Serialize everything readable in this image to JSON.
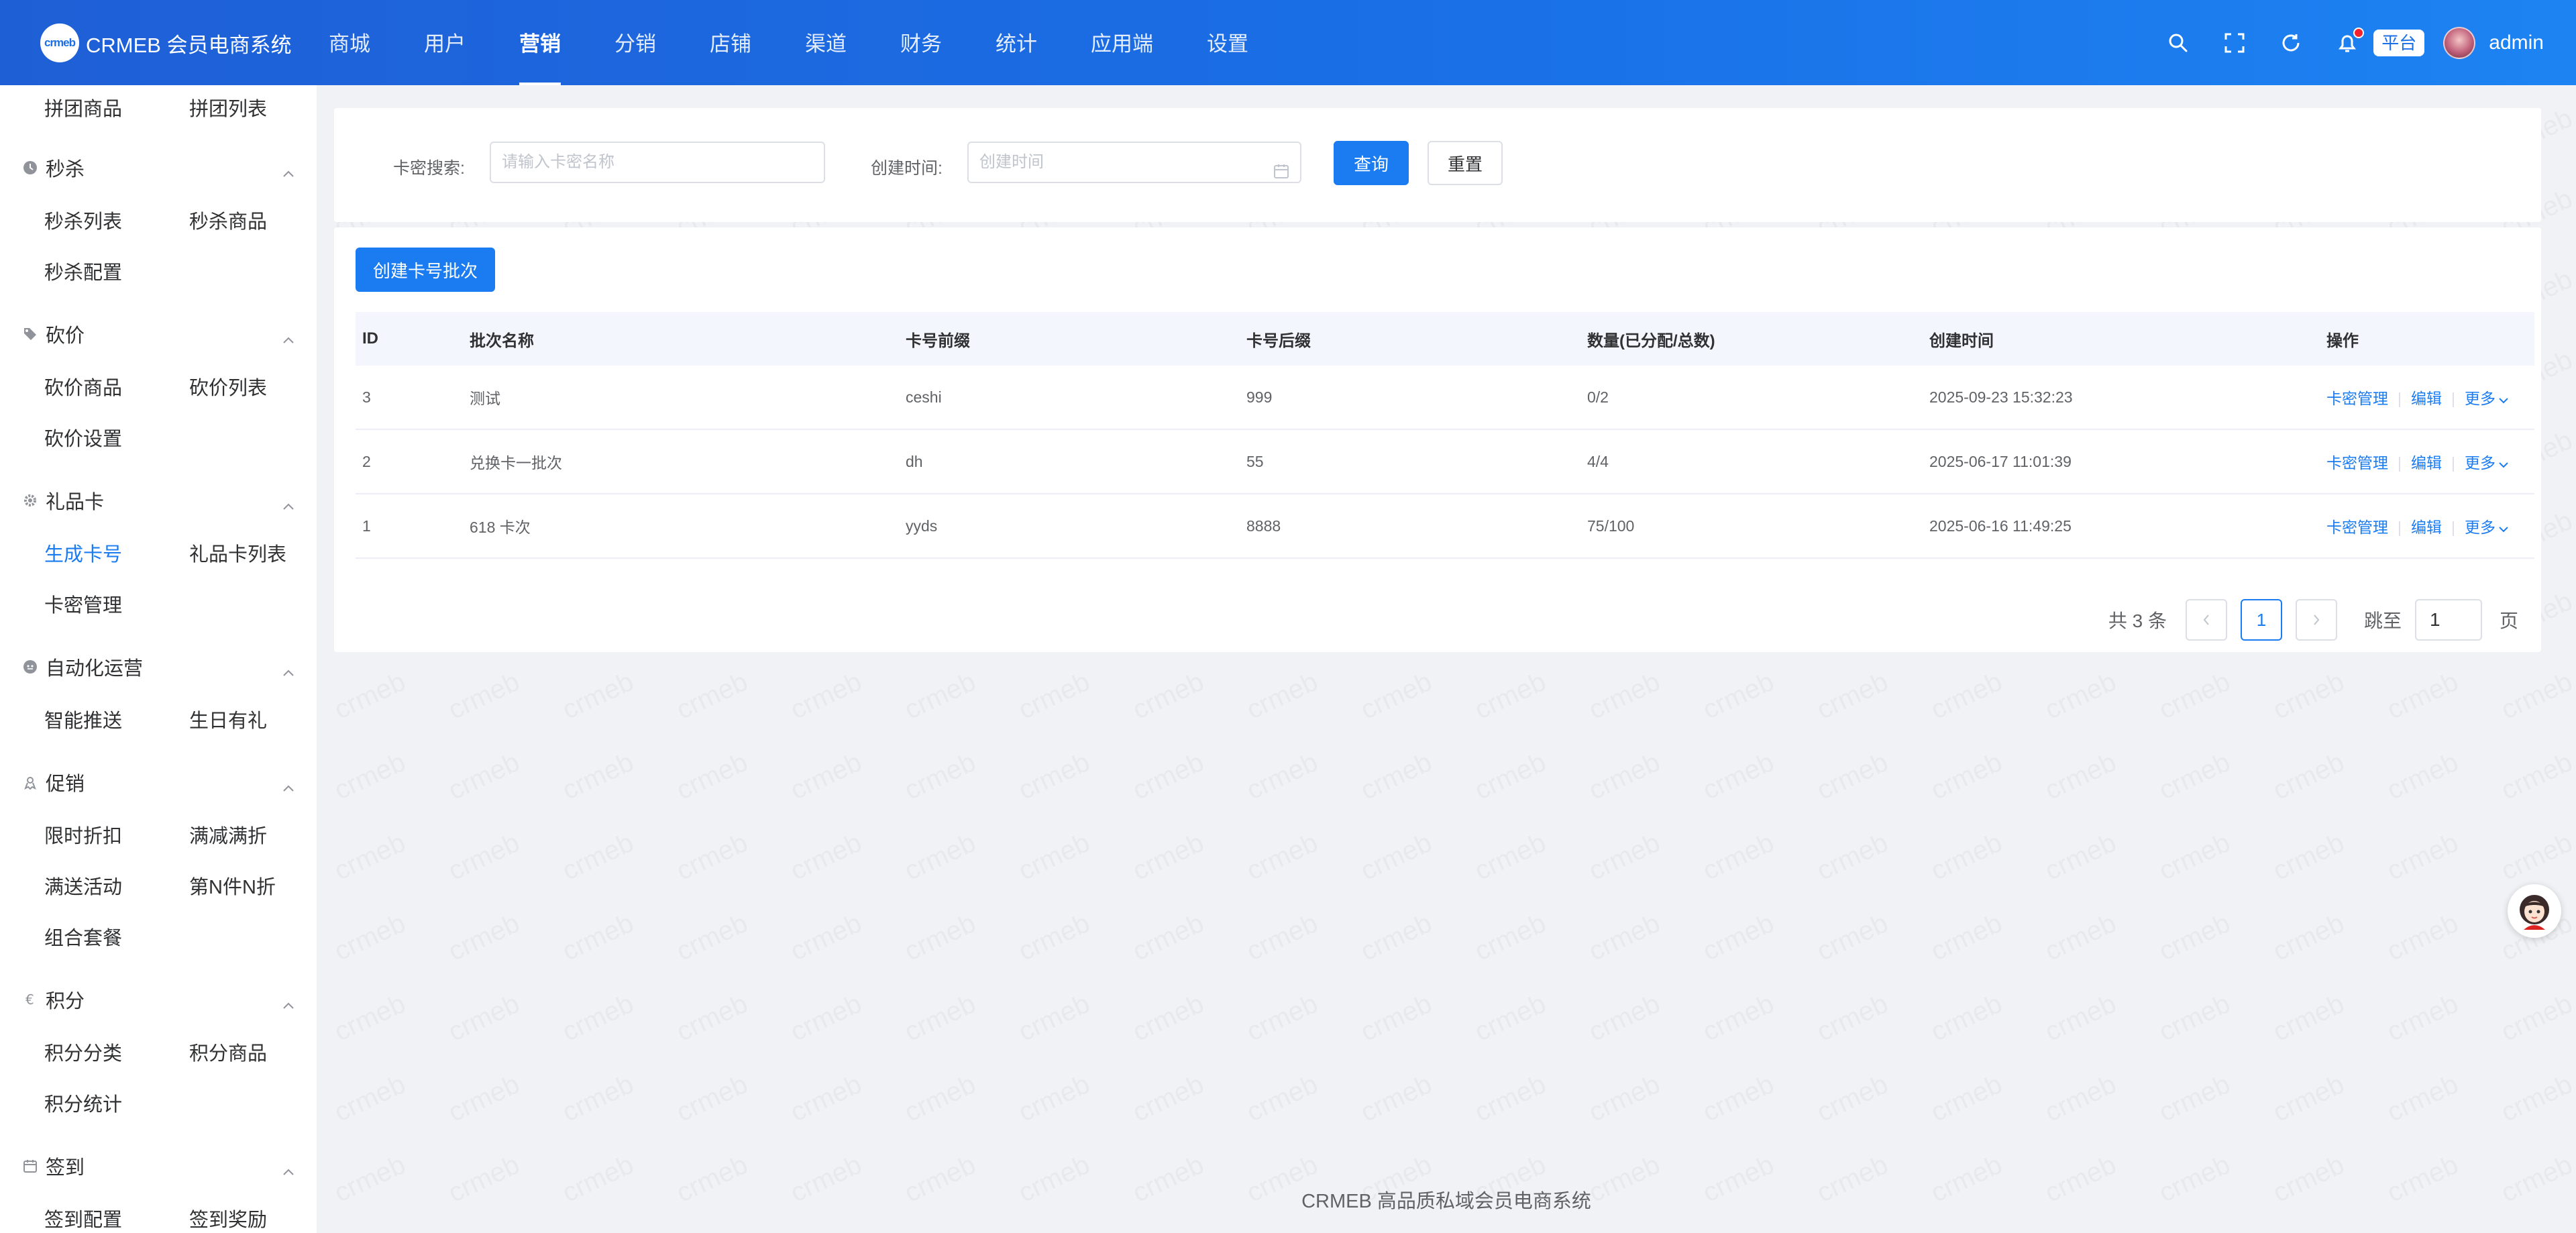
{
  "header": {
    "logo_mark": "crmeb",
    "app_title": "CRMEB 会员电商系统",
    "nav": [
      "商城",
      "用户",
      "营销",
      "分销",
      "店铺",
      "渠道",
      "财务",
      "统计",
      "应用端",
      "设置"
    ],
    "active_nav": "营销",
    "platform_tag": "平台",
    "user_name": "admin",
    "accent": "#1a6fe6"
  },
  "sidebar": {
    "pintuan_items": [
      "拼团商品",
      "拼团列表"
    ],
    "groups": [
      {
        "title": "秒杀",
        "icon": "clock-icon",
        "items": [
          "秒杀列表",
          "秒杀商品",
          "秒杀配置"
        ]
      },
      {
        "title": "砍价",
        "icon": "tag-icon",
        "items": [
          "砍价商品",
          "砍价列表",
          "砍价设置"
        ]
      },
      {
        "title": "礼品卡",
        "icon": "gear-icon",
        "items": [
          "生成卡号",
          "礼品卡列表",
          "卡密管理"
        ]
      },
      {
        "title": "自动化运营",
        "icon": "robot-icon",
        "items": [
          "智能推送",
          "生日有礼"
        ]
      },
      {
        "title": "促销",
        "icon": "promo-icon",
        "items": [
          "限时折扣",
          "满减满折",
          "满送活动",
          "第N件N折",
          "组合套餐"
        ]
      },
      {
        "title": "积分",
        "icon": "points-icon",
        "items": [
          "积分分类",
          "积分商品",
          "积分统计"
        ]
      },
      {
        "title": "签到",
        "icon": "calendar-icon",
        "items": [
          "签到配置",
          "签到奖励"
        ]
      }
    ],
    "active_item": "生成卡号"
  },
  "search": {
    "card_label": "卡密搜索:",
    "card_placeholder": "请输入卡密名称",
    "time_label": "创建时间:",
    "time_placeholder": "创建时间",
    "query_button": "查询",
    "reset_button": "重置"
  },
  "table": {
    "create_button": "创建卡号批次",
    "columns": [
      "ID",
      "批次名称",
      "卡号前缀",
      "卡号后缀",
      "数量(已分配/总数)",
      "创建时间",
      "操作"
    ],
    "rows": [
      {
        "id": "3",
        "name": "测试",
        "prefix": "ceshi",
        "suffix": "999",
        "count": "0/2",
        "time": "2025-09-23 15:32:23"
      },
      {
        "id": "2",
        "name": "兑换卡一批次",
        "prefix": "dh",
        "suffix": "55",
        "count": "4/4",
        "time": "2025-06-17 11:01:39"
      },
      {
        "id": "1",
        "name": "618 卡次",
        "prefix": "yyds",
        "suffix": "8888",
        "count": "75/100",
        "time": "2025-06-16 11:49:25"
      }
    ],
    "ops": {
      "manage": "卡密管理",
      "edit": "编辑",
      "more": "更多"
    }
  },
  "pagination": {
    "total_text": "共 3 条",
    "current": "1",
    "jump_label": "跳至",
    "jump_value": "1",
    "page_suffix": "页"
  },
  "footer": "CRMEB 高品质私域会员电商系统"
}
